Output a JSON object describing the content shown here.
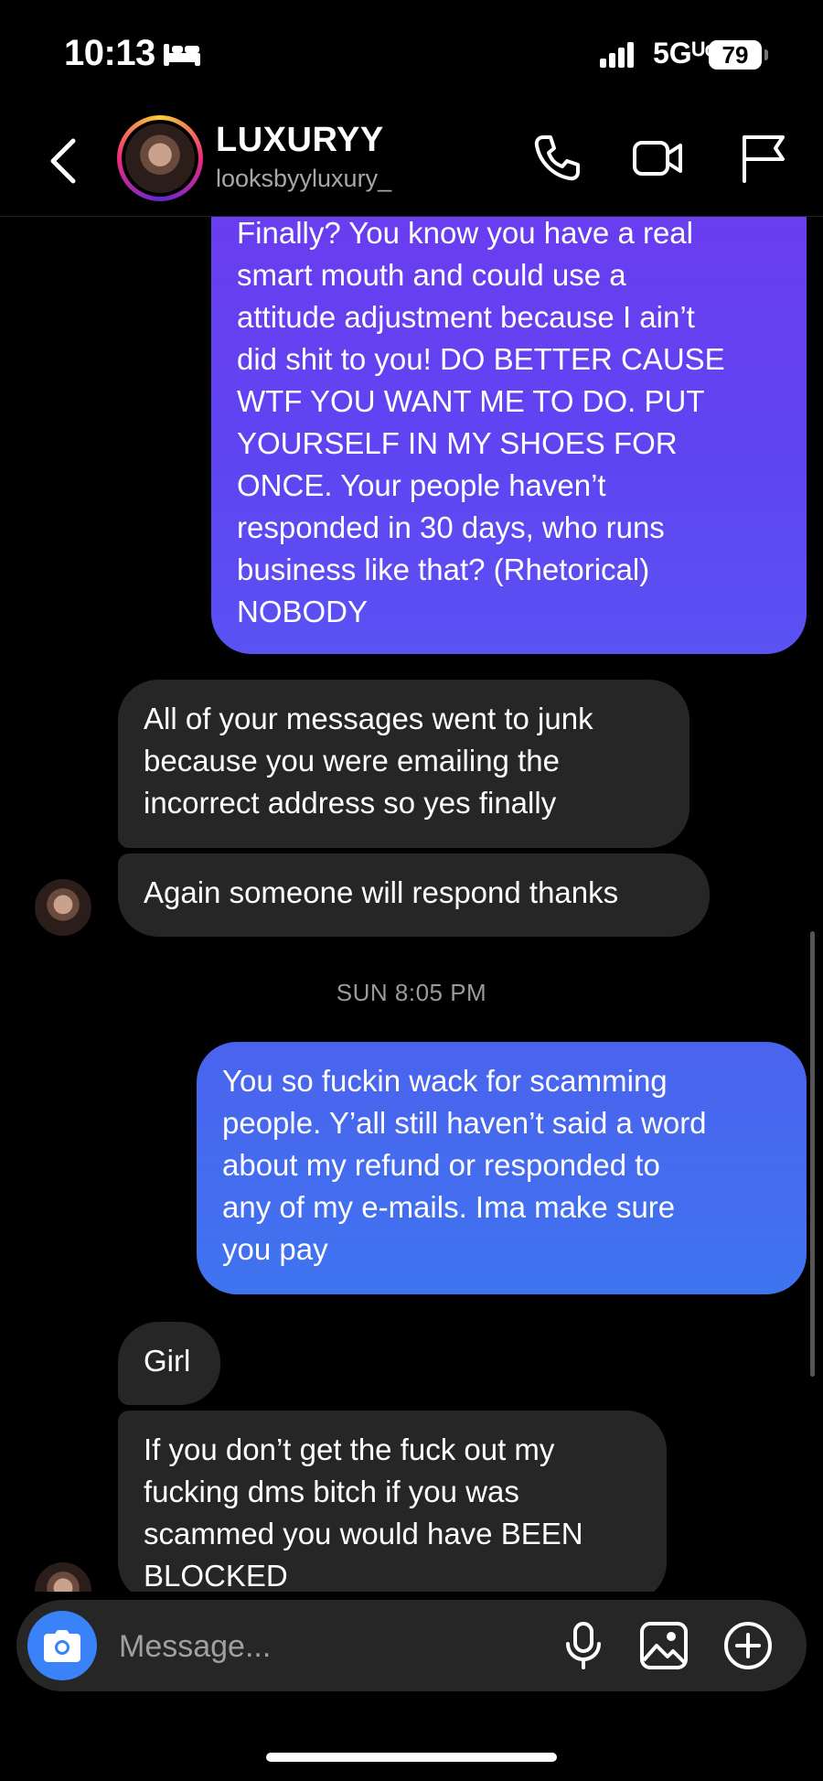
{
  "status_bar": {
    "time": "10:13",
    "network": "5Gᵁᶜ",
    "battery": "79"
  },
  "header": {
    "name": "LUXURYY",
    "handle": "looksbyyluxury_"
  },
  "messages": [
    {
      "from": "me",
      "text": "Finally? You know you have a real\nsmart mouth and could use a\nattitude adjustment because I ain’t\ndid shit to you! DO BETTER CAUSE\nWTF YOU WANT ME TO DO. PUT\nYOURSELF IN MY SHOES FOR\nONCE. Your people haven’t\nresponded in 30 days, who runs\nbusiness like that? (Rhetorical)\nNOBODY"
    },
    {
      "from": "them",
      "text": "All of your messages went to junk\nbecause  you were emailing the\nincorrect address so yes finally"
    },
    {
      "from": "them",
      "text": "Again someone will respond thanks"
    },
    {
      "from": "me",
      "text": "You so fuckin wack for scamming\npeople. Y’all still haven’t said a word\nabout my refund or responded to\nany of my e-mails. Ima make sure\nyou pay"
    },
    {
      "from": "them",
      "text": "Girl"
    },
    {
      "from": "them",
      "text": "If you don’t get the fuck out my\nfucking dms bitch if you was\nscammed you would have BEEN\nBLOCKED"
    }
  ],
  "timestamp": "SUN 8:05 PM",
  "composer": {
    "placeholder": "Message..."
  },
  "colors": {
    "sent_purple": "#6a3cf0",
    "sent_blue": "#3f74ef",
    "received": "#262626",
    "camera_button": "#3a82f7"
  },
  "icons": [
    "back-icon",
    "phone-icon",
    "video-icon",
    "flag-icon",
    "camera-icon",
    "microphone-icon",
    "gallery-icon",
    "plus-circle-icon",
    "bed-icon",
    "signal-icon"
  ]
}
